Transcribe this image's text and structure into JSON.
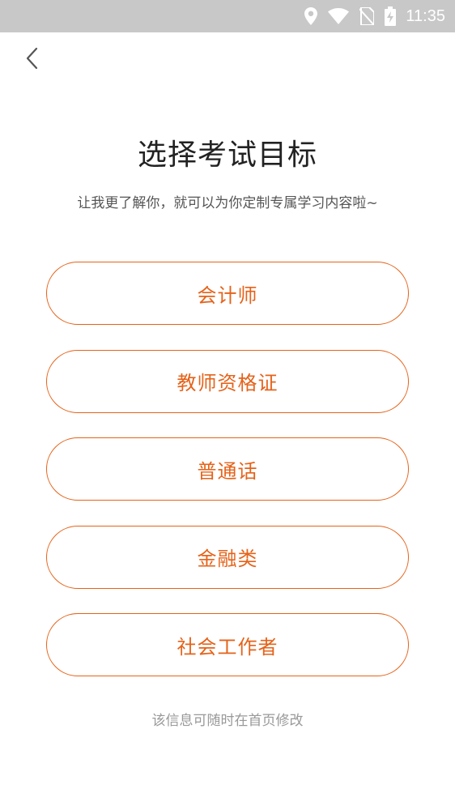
{
  "status_bar": {
    "time": "11:35",
    "icons": [
      "location-icon",
      "wifi-icon",
      "no-sim-icon",
      "battery-charging-icon"
    ]
  },
  "header": {
    "back_icon": "chevron-left-icon"
  },
  "main": {
    "title": "选择考试目标",
    "subtitle": "让我更了解你，就可以为你定制专属学习内容啦~",
    "options": [
      {
        "label": "会计师"
      },
      {
        "label": "教师资格证"
      },
      {
        "label": "普通话"
      },
      {
        "label": "金融类"
      },
      {
        "label": "社会工作者"
      }
    ],
    "footer_note": "该信息可随时在首页修改"
  },
  "colors": {
    "accent": "#e5631a",
    "status_bar_bg": "#c8c8c8",
    "title_text": "#222222",
    "subtitle_text": "#555555",
    "footer_text": "#999999"
  }
}
